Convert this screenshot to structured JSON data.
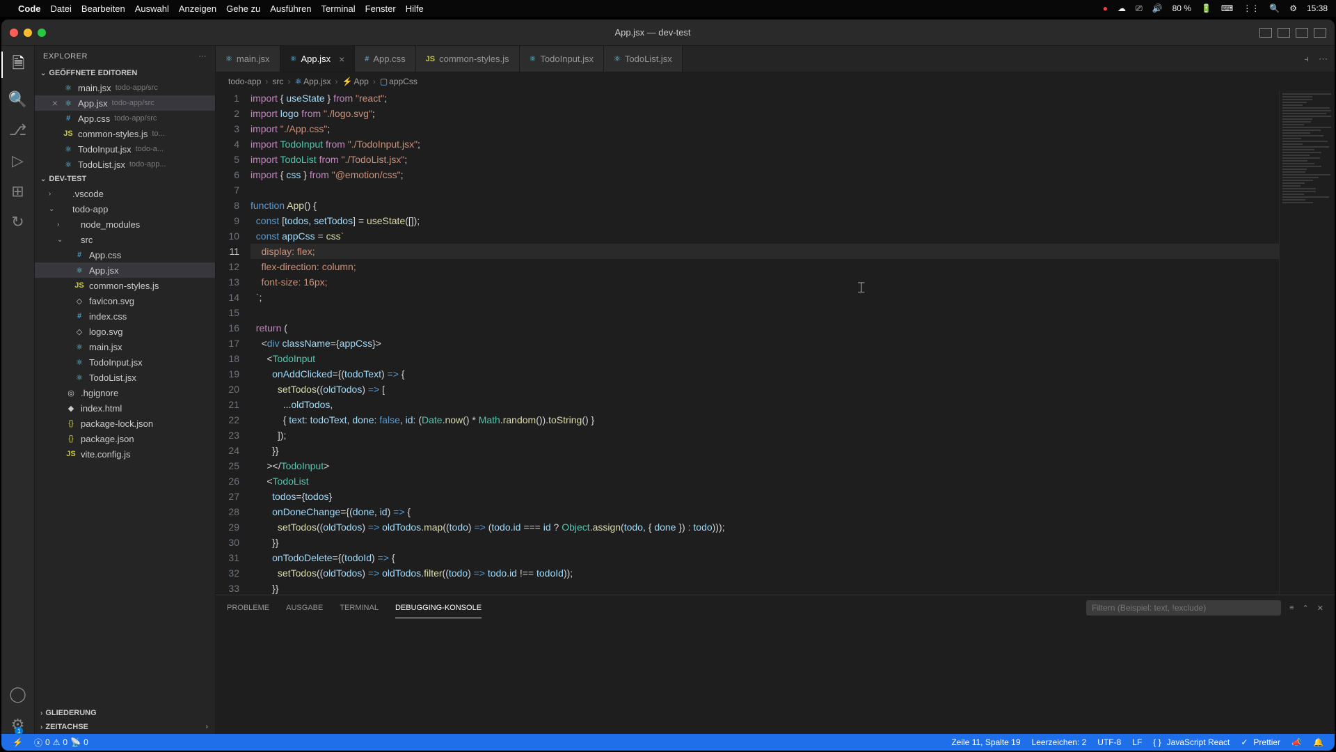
{
  "menubar": {
    "app": "Code",
    "items": [
      "Datei",
      "Bearbeiten",
      "Auswahl",
      "Anzeigen",
      "Gehe zu",
      "Ausführen",
      "Terminal",
      "Fenster",
      "Hilfe"
    ],
    "battery": "80 %",
    "time": "15:38"
  },
  "window": {
    "title": "App.jsx — dev-test"
  },
  "sidebar": {
    "title": "EXPLORER",
    "sections": {
      "openEditors": "GEÖFFNETE EDITOREN",
      "project": "DEV-TEST",
      "outline": "GLIEDERUNG",
      "timeline": "ZEITACHSE"
    },
    "openEditors": [
      {
        "name": "main.jsx",
        "path": "todo-app/src",
        "icon": "react"
      },
      {
        "name": "App.jsx",
        "path": "todo-app/src",
        "icon": "react",
        "close": true,
        "active": true
      },
      {
        "name": "App.css",
        "path": "todo-app/src",
        "icon": "css"
      },
      {
        "name": "common-styles.js",
        "path": "to...",
        "icon": "js"
      },
      {
        "name": "TodoInput.jsx",
        "path": "todo-a...",
        "icon": "react"
      },
      {
        "name": "TodoList.jsx",
        "path": "todo-app...",
        "icon": "react"
      }
    ],
    "tree": [
      {
        "name": ".vscode",
        "type": "folder",
        "depth": 1
      },
      {
        "name": "todo-app",
        "type": "folder",
        "depth": 1,
        "open": true
      },
      {
        "name": "node_modules",
        "type": "folder",
        "depth": 2
      },
      {
        "name": "src",
        "type": "folder",
        "depth": 2,
        "open": true
      },
      {
        "name": "App.css",
        "type": "css",
        "depth": 3
      },
      {
        "name": "App.jsx",
        "type": "react",
        "depth": 3,
        "selected": true
      },
      {
        "name": "common-styles.js",
        "type": "js",
        "depth": 3
      },
      {
        "name": "favicon.svg",
        "type": "svg",
        "depth": 3
      },
      {
        "name": "index.css",
        "type": "css",
        "depth": 3
      },
      {
        "name": "logo.svg",
        "type": "svg",
        "depth": 3
      },
      {
        "name": "main.jsx",
        "type": "react",
        "depth": 3
      },
      {
        "name": "TodoInput.jsx",
        "type": "react",
        "depth": 3
      },
      {
        "name": "TodoList.jsx",
        "type": "react",
        "depth": 3
      },
      {
        "name": ".hgignore",
        "type": "file",
        "depth": 2
      },
      {
        "name": "index.html",
        "type": "html",
        "depth": 2
      },
      {
        "name": "package-lock.json",
        "type": "json",
        "depth": 2
      },
      {
        "name": "package.json",
        "type": "json",
        "depth": 2
      },
      {
        "name": "vite.config.js",
        "type": "js",
        "depth": 2
      }
    ]
  },
  "tabs": [
    {
      "name": "main.jsx",
      "icon": "react"
    },
    {
      "name": "App.jsx",
      "icon": "react",
      "active": true,
      "close": true
    },
    {
      "name": "App.css",
      "icon": "css"
    },
    {
      "name": "common-styles.js",
      "icon": "js"
    },
    {
      "name": "TodoInput.jsx",
      "icon": "react"
    },
    {
      "name": "TodoList.jsx",
      "icon": "react"
    }
  ],
  "breadcrumbs": [
    "todo-app",
    "src",
    "App.jsx",
    "App",
    "appCss"
  ],
  "code": {
    "startLine": 1,
    "activeLine": 11,
    "lines": [
      "<span class='kw'>import</span> <span class='pun'>{</span> <span class='var'>useState</span> <span class='pun'>}</span> <span class='kw'>from</span> <span class='str'>\"react\"</span><span class='pun'>;</span>",
      "<span class='kw'>import</span> <span class='var'>logo</span> <span class='kw'>from</span> <span class='str'>\"./logo.svg\"</span><span class='pun'>;</span>",
      "<span class='kw'>import</span> <span class='str'>\"./App.css\"</span><span class='pun'>;</span>",
      "<span class='kw'>import</span> <span class='cls'>TodoInput</span> <span class='kw'>from</span> <span class='str'>\"./TodoInput.jsx\"</span><span class='pun'>;</span>",
      "<span class='kw'>import</span> <span class='cls'>TodoList</span> <span class='kw'>from</span> <span class='str'>\"./TodoList.jsx\"</span><span class='pun'>;</span>",
      "<span class='kw'>import</span> <span class='pun'>{</span> <span class='var'>css</span> <span class='pun'>}</span> <span class='kw'>from</span> <span class='str'>\"@emotion/css\"</span><span class='pun'>;</span>",
      "",
      "<span class='kw2'>function</span> <span class='fn'>App</span><span class='pun'>() {</span>",
      "  <span class='kw2'>const</span> <span class='pun'>[</span><span class='var'>todos</span><span class='pun'>,</span> <span class='var'>setTodos</span><span class='pun'>]</span> <span class='op'>=</span> <span class='fn'>useState</span><span class='pun'>([]);</span>",
      "  <span class='kw2'>const</span> <span class='var'>appCss</span> <span class='op'>=</span> <span class='fn'>css</span><span class='str'>`</span>",
      "<span class='str'>    display: flex;</span>",
      "<span class='str'>    flex-direction: column;</span>",
      "<span class='str'>    font-size: 16px;</span>",
      "<span class='str'>  `</span><span class='pun'>;</span>",
      "",
      "  <span class='kw'>return</span> <span class='pun'>(</span>",
      "    <span class='pun'>&lt;</span><span class='kw2'>div</span> <span class='var'>className</span><span class='op'>=</span><span class='pun'>{</span><span class='var'>appCss</span><span class='pun'>}&gt;</span>",
      "      <span class='pun'>&lt;</span><span class='cls'>TodoInput</span>",
      "        <span class='var'>onAddClicked</span><span class='op'>=</span><span class='pun'>{(</span><span class='var'>todoText</span><span class='pun'>)</span> <span class='kw2'>=&gt;</span> <span class='pun'>{</span>",
      "          <span class='fn'>setTodos</span><span class='pun'>((</span><span class='var'>oldTodos</span><span class='pun'>)</span> <span class='kw2'>=&gt;</span> <span class='pun'>[</span>",
      "            <span class='op'>...</span><span class='var'>oldTodos</span><span class='pun'>,</span>",
      "            <span class='pun'>{</span> <span class='var'>text</span><span class='pun'>:</span> <span class='var'>todoText</span><span class='pun'>,</span> <span class='var'>done</span><span class='pun'>:</span> <span class='bool'>false</span><span class='pun'>,</span> <span class='var'>id</span><span class='pun'>:</span> <span class='pun'>(</span><span class='cls'>Date</span><span class='pun'>.</span><span class='fn'>now</span><span class='pun'>()</span> <span class='op'>*</span> <span class='cls'>Math</span><span class='pun'>.</span><span class='fn'>random</span><span class='pun'>()).</span><span class='fn'>toString</span><span class='pun'>() }</span>",
      "          <span class='pun'>]);</span>",
      "        <span class='pun'>}}</span>",
      "      <span class='pun'>&gt;&lt;/</span><span class='cls'>TodoInput</span><span class='pun'>&gt;</span>",
      "      <span class='pun'>&lt;</span><span class='cls'>TodoList</span>",
      "        <span class='var'>todos</span><span class='op'>=</span><span class='pun'>{</span><span class='var'>todos</span><span class='pun'>}</span>",
      "        <span class='var'>onDoneChange</span><span class='op'>=</span><span class='pun'>{(</span><span class='var'>done</span><span class='pun'>,</span> <span class='var'>id</span><span class='pun'>)</span> <span class='kw2'>=&gt;</span> <span class='pun'>{</span>",
      "          <span class='fn'>setTodos</span><span class='pun'>((</span><span class='var'>oldTodos</span><span class='pun'>)</span> <span class='kw2'>=&gt;</span> <span class='var'>oldTodos</span><span class='pun'>.</span><span class='fn'>map</span><span class='pun'>((</span><span class='var'>todo</span><span class='pun'>)</span> <span class='kw2'>=&gt;</span> <span class='pun'>(</span><span class='var'>todo</span><span class='pun'>.</span><span class='var'>id</span> <span class='op'>===</span> <span class='var'>id</span> <span class='op'>?</span> <span class='cls'>Object</span><span class='pun'>.</span><span class='fn'>assign</span><span class='pun'>(</span><span class='var'>todo</span><span class='pun'>, {</span> <span class='var'>done</span> <span class='pun'>}) :</span> <span class='var'>todo</span><span class='pun'>)));</span>",
      "        <span class='pun'>}}</span>",
      "        <span class='var'>onTodoDelete</span><span class='op'>=</span><span class='pun'>{(</span><span class='var'>todoId</span><span class='pun'>)</span> <span class='kw2'>=&gt;</span> <span class='pun'>{</span>",
      "          <span class='fn'>setTodos</span><span class='pun'>((</span><span class='var'>oldTodos</span><span class='pun'>)</span> <span class='kw2'>=&gt;</span> <span class='var'>oldTodos</span><span class='pun'>.</span><span class='fn'>filter</span><span class='pun'>((</span><span class='var'>todo</span><span class='pun'>)</span> <span class='kw2'>=&gt;</span> <span class='var'>todo</span><span class='pun'>.</span><span class='var'>id</span> <span class='op'>!==</span> <span class='var'>todoId</span><span class='pun'>));</span>",
      "        <span class='pun'>}}</span>"
    ]
  },
  "panel": {
    "tabs": [
      "PROBLEME",
      "AUSGABE",
      "TERMINAL",
      "DEBUGGING-KONSOLE"
    ],
    "activeTab": 3,
    "filterPlaceholder": "Filtern (Beispiel: text, !exclude)"
  },
  "statusbar": {
    "remote": "",
    "errors": "0",
    "warnings": "0",
    "ports": "0",
    "cursor": "Zeile 11, Spalte 19",
    "selection": "Leerzeichen: 2",
    "encoding": "UTF-8",
    "eol": "LF",
    "language": "JavaScript React",
    "prettier": "Prettier"
  }
}
